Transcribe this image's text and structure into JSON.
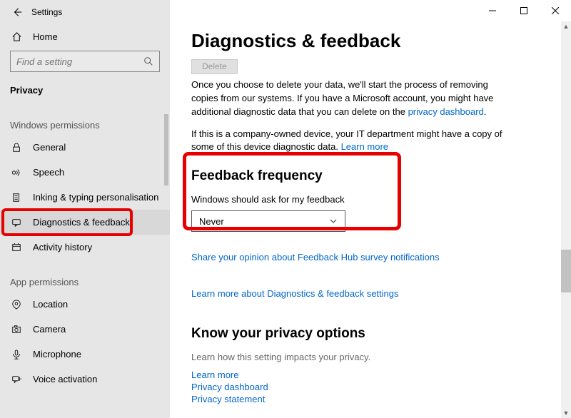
{
  "app_title": "Settings",
  "home_label": "Home",
  "search_placeholder": "Find a setting",
  "privacy_label": "Privacy",
  "groups": {
    "windows_permissions": "Windows permissions",
    "app_permissions": "App permissions"
  },
  "nav": {
    "general": "General",
    "speech": "Speech",
    "inking": "Inking & typing personalisation",
    "diagnostics": "Diagnostics & feedback",
    "activity_history": "Activity history",
    "location": "Location",
    "camera": "Camera",
    "microphone": "Microphone",
    "voice_activation": "Voice activation"
  },
  "page": {
    "title": "Diagnostics & feedback",
    "delete_btn": "Delete",
    "delete_para_1": "Once you choose to delete your data, we'll start the process of removing copies from our systems. If you have a Microsoft account, you might have additional diagnostic data that you can delete on the ",
    "privacy_dashboard_link": "privacy dashboard",
    "company_para": "If this is a company-owned device, your IT department might have a copy of some of this device diagnostic data. ",
    "learn_more_link": "Learn more",
    "feedback_heading": "Feedback frequency",
    "feedback_label": "Windows should ask for my feedback",
    "feedback_value": "Never",
    "share_opinion_link": "Share your opinion about Feedback Hub survey notifications",
    "learn_diag_link": "Learn more about Diagnostics & feedback settings",
    "privacy_heading": "Know your privacy options",
    "privacy_sub": "Learn how this setting impacts your privacy.",
    "privacy_learn_more": "Learn more",
    "privacy_dashboard": "Privacy dashboard",
    "privacy_statement": "Privacy statement"
  }
}
